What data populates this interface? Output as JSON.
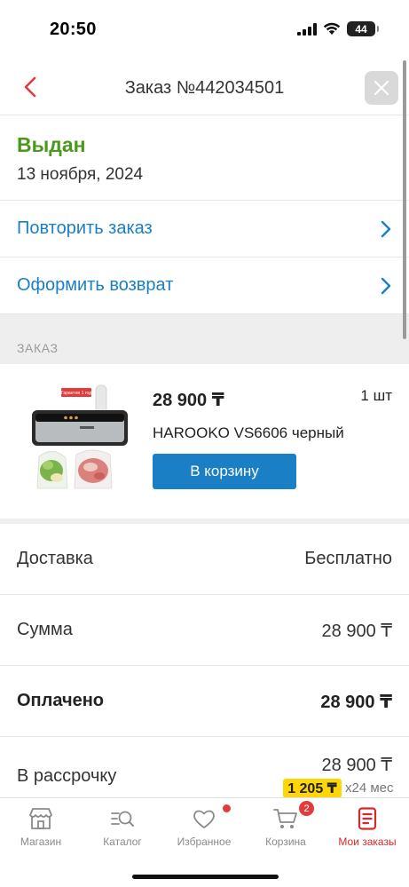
{
  "status_bar": {
    "time": "20:50",
    "battery": "44"
  },
  "header": {
    "title": "Заказ №442034501"
  },
  "order": {
    "status": "Выдан",
    "date": "13 ноября, 2024"
  },
  "actions": {
    "repeat": "Повторить заказ",
    "return": "Оформить возврат"
  },
  "section": {
    "label": "ЗАКАЗ"
  },
  "product": {
    "price": "28 900 ₸",
    "qty": "1 шт",
    "name": "HAROOKO VS6606 черный",
    "cart_button": "В корзину",
    "image_tag": "Гарантия 1 год"
  },
  "summary": {
    "delivery_label": "Доставка",
    "delivery_value": "Бесплатно",
    "sum_label": "Сумма",
    "sum_value": "28 900 ₸",
    "paid_label": "Оплачено",
    "paid_value": "28 900 ₸",
    "installment_label": "В рассрочку",
    "installment_value": "28 900 ₸",
    "installment_monthly": "1 205 ₸",
    "installment_term": "x24 мес"
  },
  "tabs": [
    {
      "label": "Магазин",
      "icon": "store-icon"
    },
    {
      "label": "Каталог",
      "icon": "catalog-search-icon"
    },
    {
      "label": "Избранное",
      "icon": "heart-icon"
    },
    {
      "label": "Корзина",
      "icon": "cart-icon",
      "badge": "2"
    },
    {
      "label": "Мои заказы",
      "icon": "orders-icon"
    }
  ],
  "colors": {
    "accent": "#1a7fc4",
    "status_green": "#4a9a1a",
    "active_tab": "#d8282a",
    "badge_yellow": "#ffd60a"
  }
}
